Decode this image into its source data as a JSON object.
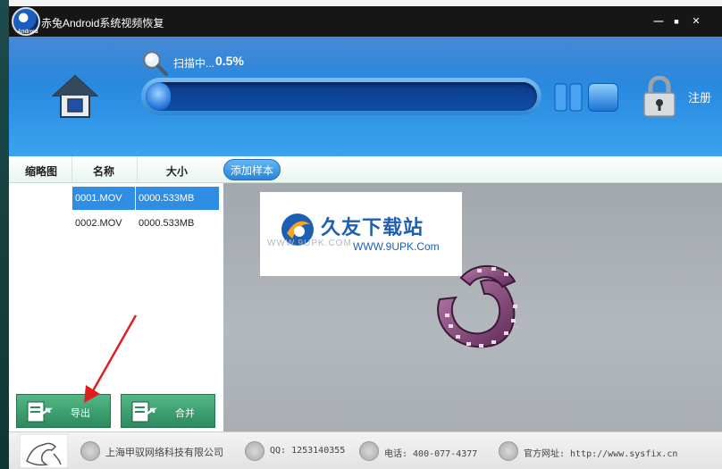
{
  "window": {
    "title": "赤兔Android系统视频恢复",
    "logo_text": "Android",
    "minimize": "—",
    "maximize": "■",
    "close": "✕"
  },
  "scan": {
    "label": "扫描中...",
    "percent_text": "0.5%",
    "progress": 0.005
  },
  "header": {
    "register_label": "注册"
  },
  "columns": {
    "thumbnail": "缩略图",
    "name": "名称",
    "size": "大小"
  },
  "add_sample_label": "添加样本",
  "files": [
    {
      "name": "0001.MOV",
      "size": "0000.533MB",
      "selected": true
    },
    {
      "name": "0002.MOV",
      "size": "0000.533MB",
      "selected": false
    }
  ],
  "watermark": {
    "title": "久友下载站",
    "domain": "WWW.9UPK.Com",
    "www": "WWW.9UPK.COM"
  },
  "actions": {
    "export_label": "导出",
    "merge_label": "合并"
  },
  "footer": {
    "company": "上海甲驭网络科技有限公司",
    "qq": "QQ: 1253140355",
    "phone": "电话: 400-077-4377",
    "website": "官方网址: http://www.sysfix.cn"
  },
  "colors": {
    "accent_blue": "#2a8be0",
    "selected_row": "#2f8de4",
    "button_green": "#3aa073",
    "annotation_red": "#e02020"
  }
}
